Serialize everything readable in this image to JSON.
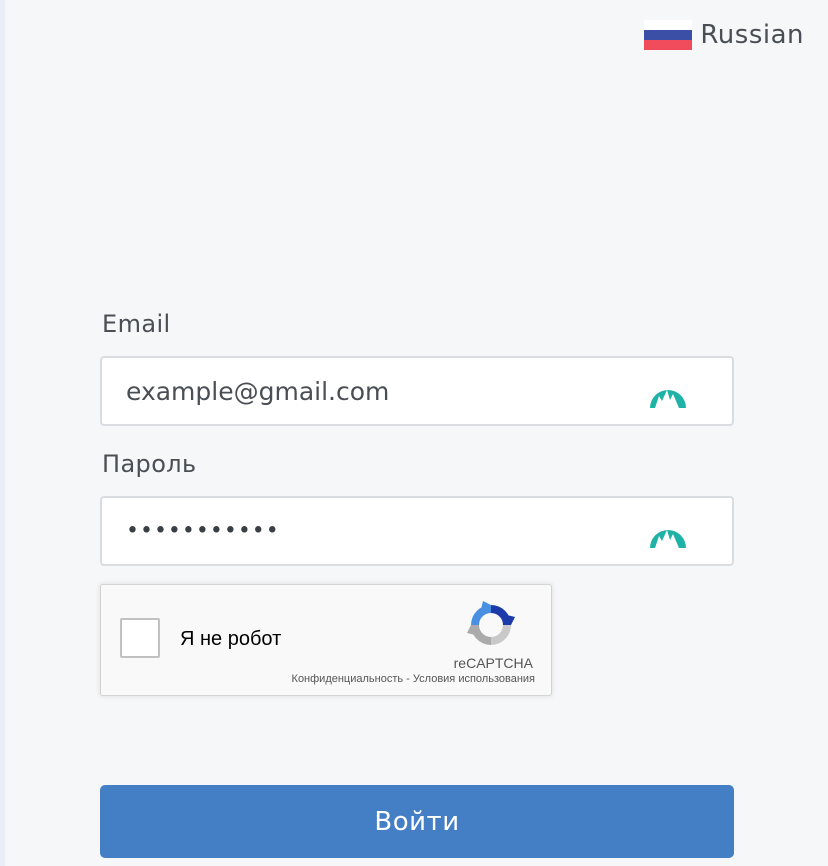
{
  "language": {
    "label": "Russian",
    "flag_colors": [
      "#ffffff",
      "#3c4fa6",
      "#f04c5c"
    ]
  },
  "form": {
    "email_label": "Email",
    "email_placeholder": "example@gmail.com",
    "password_label": "Пароль",
    "password_value": "•••••••••••",
    "field_icon": "nordpass-mountain-icon",
    "icon_color": "#1fb3a8"
  },
  "recaptcha": {
    "checkbox_label": "Я не робот",
    "brand": "reCAPTCHA",
    "privacy_link": "Конфиденциальность",
    "separator": " - ",
    "terms_link": "Условия использования"
  },
  "submit": {
    "label": "Войти",
    "color": "#447fc6"
  }
}
